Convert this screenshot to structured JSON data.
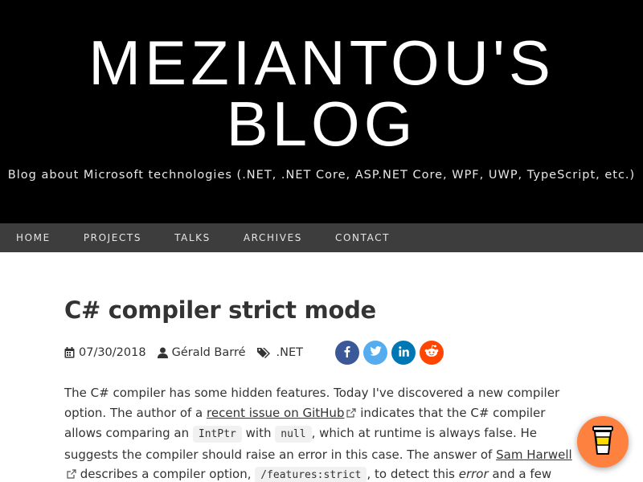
{
  "header": {
    "title_line1": "MEZIANTOU'S",
    "title_line2": "BLOG",
    "tagline": "Blog about Microsoft technologies (.NET, .NET Core, ASP.NET Core, WPF, UWP, TypeScript, etc.)"
  },
  "nav": {
    "items": [
      {
        "label": "HOME"
      },
      {
        "label": "PROJECTS"
      },
      {
        "label": "TALKS"
      },
      {
        "label": "ARCHIVES"
      },
      {
        "label": "CONTACT"
      }
    ]
  },
  "post": {
    "title": "C# compiler strict mode",
    "date": "07/30/2018",
    "author": "Gérald Barré",
    "tag": ".NET",
    "share": {
      "facebook_icon": "facebook-icon",
      "twitter_icon": "twitter-icon",
      "linkedin_icon": "linkedin-icon",
      "reddit_icon": "reddit-icon"
    },
    "body": {
      "t1": "The C# compiler has some hidden features. Today I've discovered a new compiler option. The author of a ",
      "link1": "recent issue on GitHub",
      "t2": " indicates that the C# compiler allows comparing an ",
      "code1": "IntPtr",
      "t3": " with ",
      "code2": "null",
      "t4": ", which at runtime is always false. He suggests the compiler should raise an error in this case. The answer of ",
      "link2": "Sam Harwell",
      "t5": " describes a compiler option, ",
      "code3": "/features:strict",
      "t6": ", to detect this ",
      "em1": "error",
      "t7": " and a few other potential"
    }
  },
  "colors": {
    "header_bg": "#000000",
    "nav_bg": "#3d3d3d",
    "facebook": "#3b5998",
    "twitter": "#55acee",
    "linkedin": "#0077b5",
    "reddit": "#ff4500",
    "coffee_button": "#ff813f"
  },
  "coffee_button": {
    "icon": "coffee-cup-icon"
  }
}
